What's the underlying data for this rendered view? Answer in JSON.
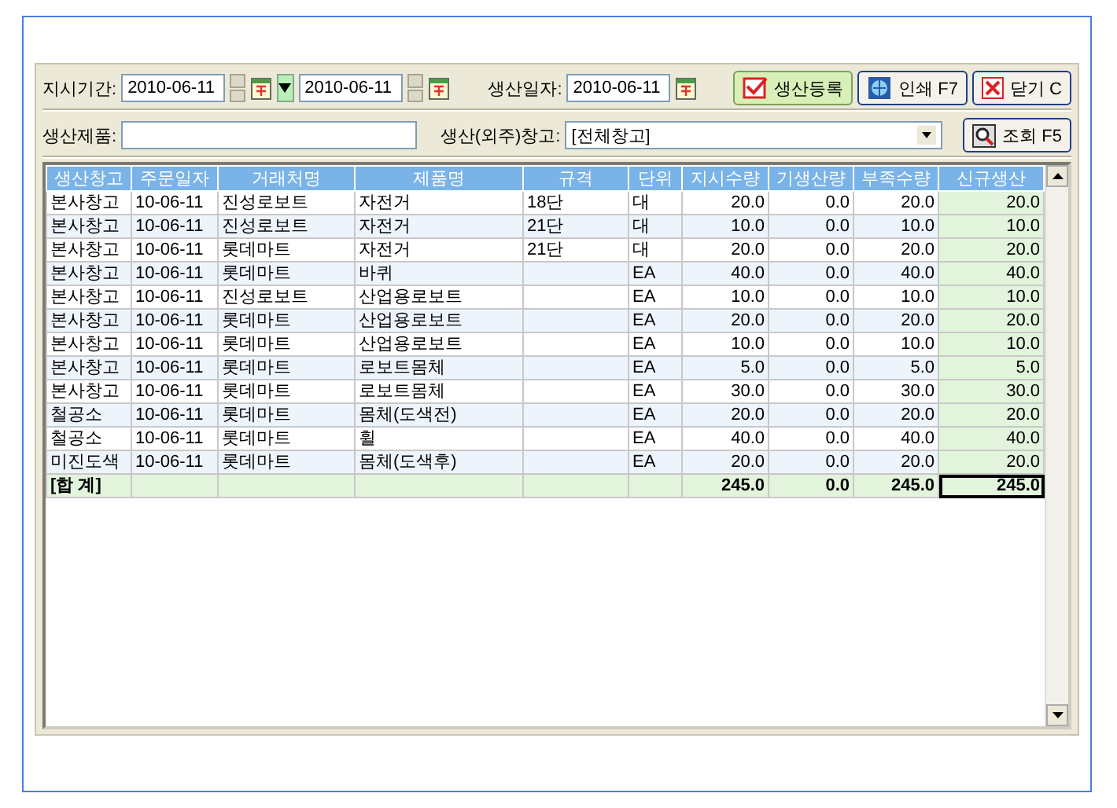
{
  "filters": {
    "period_label": "지시기간:",
    "date_from": "2010-06-11",
    "date_to": "2010-06-11",
    "production_date_label": "생산일자:",
    "production_date": "2010-06-11",
    "product_label": "생산제품:",
    "warehouse_label": "생산(외주)창고:",
    "warehouse_value": "[전체창고]"
  },
  "buttons": [
    {
      "label": "생산등록",
      "kind": "register"
    },
    {
      "label": "인쇄 F7",
      "kind": "print"
    },
    {
      "label": "닫기 C",
      "kind": "close"
    }
  ],
  "search_button": {
    "label": "조회 F5"
  },
  "table": {
    "columns": [
      "생산창고",
      "주문일자",
      "거래처명",
      "제품명",
      "규격",
      "단위",
      "지시수량",
      "기생산량",
      "부족수량",
      "신규생산"
    ],
    "rows": [
      [
        "본사창고",
        "10-06-11",
        "진성로보트",
        "자전거",
        "18단",
        "대",
        "20.0",
        "0.0",
        "20.0",
        "20.0"
      ],
      [
        "본사창고",
        "10-06-11",
        "진성로보트",
        "자전거",
        "21단",
        "대",
        "10.0",
        "0.0",
        "10.0",
        "10.0"
      ],
      [
        "본사창고",
        "10-06-11",
        "롯데마트",
        "자전거",
        "21단",
        "대",
        "20.0",
        "0.0",
        "20.0",
        "20.0"
      ],
      [
        "본사창고",
        "10-06-11",
        "롯데마트",
        "바퀴",
        "",
        "EA",
        "40.0",
        "0.0",
        "40.0",
        "40.0"
      ],
      [
        "본사창고",
        "10-06-11",
        "진성로보트",
        "산업용로보트",
        "",
        "EA",
        "10.0",
        "0.0",
        "10.0",
        "10.0"
      ],
      [
        "본사창고",
        "10-06-11",
        "롯데마트",
        "산업용로보트",
        "",
        "EA",
        "20.0",
        "0.0",
        "20.0",
        "20.0"
      ],
      [
        "본사창고",
        "10-06-11",
        "롯데마트",
        "산업용로보트",
        "",
        "EA",
        "10.0",
        "0.0",
        "10.0",
        "10.0"
      ],
      [
        "본사창고",
        "10-06-11",
        "롯데마트",
        "로보트몸체",
        "",
        "EA",
        "5.0",
        "0.0",
        "5.0",
        "5.0"
      ],
      [
        "본사창고",
        "10-06-11",
        "롯데마트",
        "로보트몸체",
        "",
        "EA",
        "30.0",
        "0.0",
        "30.0",
        "30.0"
      ],
      [
        "철공소",
        "10-06-11",
        "롯데마트",
        "몸체(도색전)",
        "",
        "EA",
        "20.0",
        "0.0",
        "20.0",
        "20.0"
      ],
      [
        "철공소",
        "10-06-11",
        "롯데마트",
        "휠",
        "",
        "EA",
        "40.0",
        "0.0",
        "40.0",
        "40.0"
      ],
      [
        "미진도색",
        "10-06-11",
        "롯데마트",
        "몸체(도색후)",
        "",
        "EA",
        "20.0",
        "0.0",
        "20.0",
        "20.0"
      ]
    ],
    "totals": [
      {
        "text": "[합 계]",
        "selected": false
      },
      {
        "selected": false
      },
      {
        "selected": false
      },
      {
        "selected": false
      },
      {
        "selected": false
      },
      {
        "selected": false
      },
      {
        "text": "245.0",
        "selected": false
      },
      {
        "text": "0.0",
        "selected": false
      },
      {
        "text": "245.0",
        "selected": false
      },
      {
        "text": "245.0",
        "selected": true
      }
    ]
  }
}
